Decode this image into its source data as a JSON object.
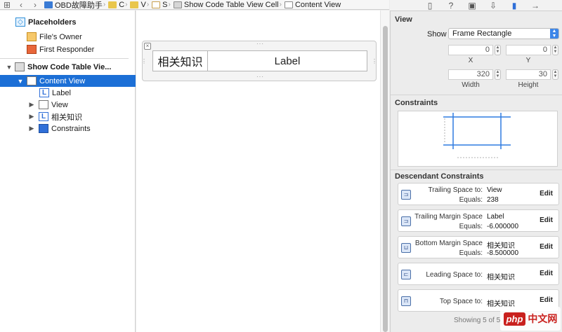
{
  "jumpbar": {
    "back_icon": "chevron-left",
    "forward_icon": "chevron-right",
    "crumbs": [
      {
        "label": "OBD故障助手",
        "icon": "app-project-icon"
      },
      {
        "label": "C",
        "icon": "folder-icon"
      },
      {
        "label": "V",
        "icon": "folder-icon"
      },
      {
        "label": "S",
        "icon": "xib-file-icon"
      },
      {
        "label": "Show Code Table View Cell",
        "icon": "table-cell-icon"
      },
      {
        "label": "Content View",
        "icon": "view-icon"
      }
    ]
  },
  "outline": {
    "placeholders": "Placeholders",
    "files_owner": "File's Owner",
    "first_responder": "First Responder",
    "cell": "Show Code Table Vie...",
    "content_view": "Content View",
    "label": "Label",
    "view": "View",
    "xiangguan": "相关知识",
    "constraints": "Constraints"
  },
  "canvas": {
    "cell_label_left": "相关知识",
    "cell_label_right": "Label"
  },
  "inspector": {
    "view_title": "View",
    "show_label": "Show",
    "show_value": "Frame Rectangle",
    "x_value": "0",
    "y_value": "0",
    "x_caption": "X",
    "y_caption": "Y",
    "width_value": "320",
    "height_value": "30",
    "width_caption": "Width",
    "height_caption": "Height",
    "constraints_title": "Constraints",
    "descendant_title": "Descendant Constraints",
    "items": [
      {
        "key1": "Trailing Space to:",
        "val1": "View",
        "key2": "Equals:",
        "val2": "238",
        "edit": "Edit"
      },
      {
        "key1": "Trailing Margin Space",
        "val1": "Label",
        "key2": "Equals:",
        "val2": "-6.000000",
        "edit": "Edit"
      },
      {
        "key1": "Bottom Margin Space",
        "val1": "相关知识",
        "key2": "Equals:",
        "val2": "-8.500000",
        "edit": "Edit"
      },
      {
        "key1": "Leading Space to:",
        "val1": "相关知识",
        "edit": "Edit"
      },
      {
        "key1": "Top Space to:",
        "val1": "相关知识",
        "edit": "Edit"
      }
    ],
    "showing": "Showing 5 of 5"
  },
  "colors": {
    "selection": "#1c6fd6",
    "accent": "#3d86e8",
    "constraint_line": "#2f7be0"
  },
  "watermark": {
    "php": "php",
    "cn": "中文网"
  }
}
